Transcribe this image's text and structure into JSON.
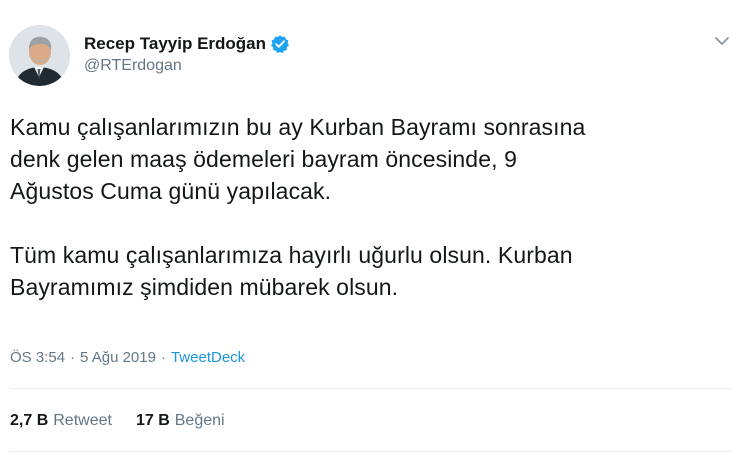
{
  "author": {
    "display_name": "Recep Tayyip Erdoğan",
    "handle": "@RTErdogan",
    "verified_icon": "verified-badge-icon",
    "avatar_icon": "profile-photo"
  },
  "menu": {
    "caret_icon": "chevron-down-icon"
  },
  "tweet": {
    "lines": [
      "Kamu çalışanlarımızın bu ay Kurban Bayramı sonrasına",
      "denk gelen maaş ödemeleri bayram öncesinde, 9",
      "Ağustos Cuma günü yapılacak.",
      "Tüm kamu çalışanlarımıza hayırlı uğurlu olsun. Kurban",
      "Bayramımız şimdiden mübarek olsun."
    ]
  },
  "meta": {
    "time": "ÖS 3:54",
    "separator": "·",
    "date": "5 Ağu 2019",
    "source": "TweetDeck"
  },
  "stats": {
    "retweets": {
      "count": "2,7 B",
      "label": "Retweet"
    },
    "likes": {
      "count": "17 B",
      "label": "Beğeni"
    }
  },
  "colors": {
    "text": "#14171a",
    "secondary": "#657786",
    "link": "#1b95e0",
    "verified": "#1da1f2",
    "divider": "#e6ecf0"
  }
}
